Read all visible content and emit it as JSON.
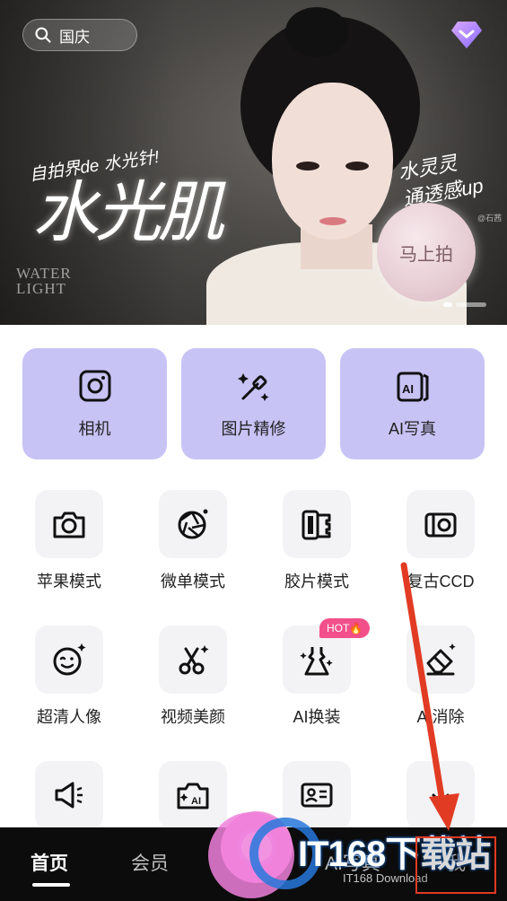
{
  "banner": {
    "search_text": "国庆",
    "slogan": "自拍界de 水光针!",
    "title": "水光肌",
    "watermark_text": "WATER\nLIGHT",
    "side_tag_line1": "水灵灵",
    "side_tag_line2": "通透感up",
    "credit": "@石茜",
    "shoot_button": "马上拍",
    "carousel_active_index": 0
  },
  "quick_actions": [
    {
      "label": "相机",
      "icon": "camera-icon"
    },
    {
      "label": "图片精修",
      "icon": "magic-wand-icon"
    },
    {
      "label": "AI写真",
      "icon": "ai-portrait-icon"
    }
  ],
  "tools": [
    {
      "label": "苹果模式",
      "icon": "camera-icon"
    },
    {
      "label": "微单模式",
      "icon": "aperture-icon"
    },
    {
      "label": "胶片模式",
      "icon": "film-icon"
    },
    {
      "label": "复古CCD",
      "icon": "retro-camera-icon"
    },
    {
      "label": "超清人像",
      "icon": "face-icon"
    },
    {
      "label": "视频美颜",
      "icon": "scissors-icon"
    },
    {
      "label": "AI换装",
      "icon": "dress-icon",
      "badge": "HOT🔥"
    },
    {
      "label": "AI消除",
      "icon": "eraser-icon"
    }
  ],
  "partial_tools": [
    {
      "icon": "megaphone-icon"
    },
    {
      "icon": "ai-camera-icon"
    },
    {
      "icon": "id-card-icon"
    },
    {
      "icon": "download-icon"
    }
  ],
  "nav": {
    "home": "首页",
    "vip": "会员",
    "ai_portrait": "AI写真",
    "me": "我"
  },
  "overlay_watermark": {
    "brand": "IT168下载站",
    "sub": "IT168 Download"
  },
  "colors": {
    "card_lavender": "#c8c3f5",
    "nav_bg": "#0c0c0c",
    "hot_badge": "#f2508a",
    "annotation_red": "#e23b24"
  }
}
